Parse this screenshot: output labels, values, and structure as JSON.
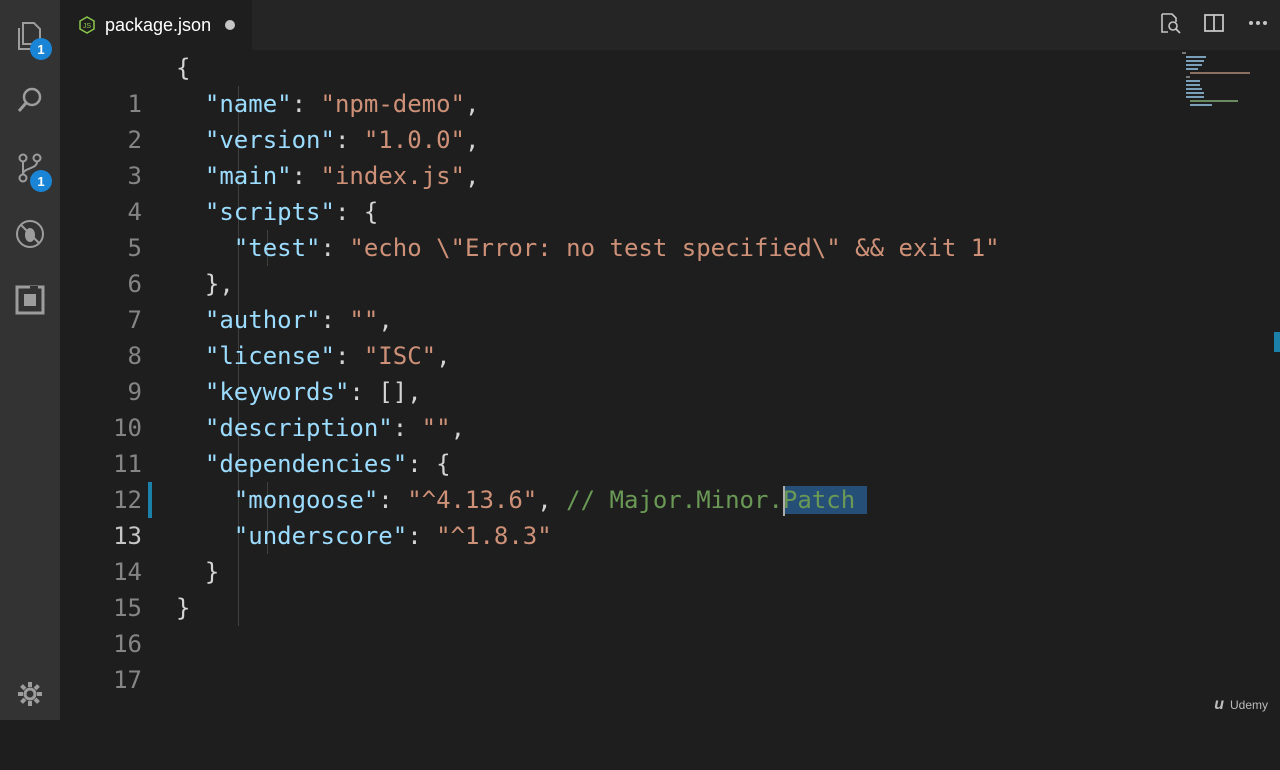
{
  "tab": {
    "label": "package.json",
    "icon": "nodejs-icon"
  },
  "activity": {
    "explorer_badge": "1",
    "scm_badge": "1"
  },
  "lines": [
    {
      "n": "1"
    },
    {
      "n": "2"
    },
    {
      "n": "3"
    },
    {
      "n": "4"
    },
    {
      "n": "5"
    },
    {
      "n": "6"
    },
    {
      "n": "7"
    },
    {
      "n": "8"
    },
    {
      "n": "9"
    },
    {
      "n": "10"
    },
    {
      "n": "11"
    },
    {
      "n": "12"
    },
    {
      "n": "13"
    },
    {
      "n": "14"
    },
    {
      "n": "15"
    },
    {
      "n": "16"
    },
    {
      "n": "17"
    }
  ],
  "code": {
    "l1": "{",
    "l2_key": "\"name\"",
    "l2_val": "\"npm-demo\"",
    "l3_key": "\"version\"",
    "l3_val": "\"1.0.0\"",
    "l4_key": "\"main\"",
    "l4_val": "\"index.js\"",
    "l5_key": "\"scripts\"",
    "l6_key": "\"test\"",
    "l6_val": "\"echo \\\"Error: no test specified\\\" && exit 1\"",
    "l7": "},",
    "l8_key": "\"author\"",
    "l8_val": "\"\"",
    "l9_key": "\"license\"",
    "l9_val": "\"ISC\"",
    "l10_key": "\"keywords\"",
    "l10_val": "[]",
    "l11_key": "\"description\"",
    "l11_val": "\"\"",
    "l12_key": "\"dependencies\"",
    "l13_key": "\"mongoose\"",
    "l13_val": "\"^4.13.6\"",
    "l13_comment": "// Major.Minor.",
    "l13_selected": "Patch",
    "l14_key": "\"underscore\"",
    "l14_val": "\"^1.8.3\"",
    "l15": "}",
    "l16": "}"
  },
  "watermark": "Udemy",
  "colors": {
    "key": "#9cdcfe",
    "string": "#ce9178",
    "comment": "#6a9955",
    "selection": "#264f78",
    "badge": "#1a85d6"
  }
}
